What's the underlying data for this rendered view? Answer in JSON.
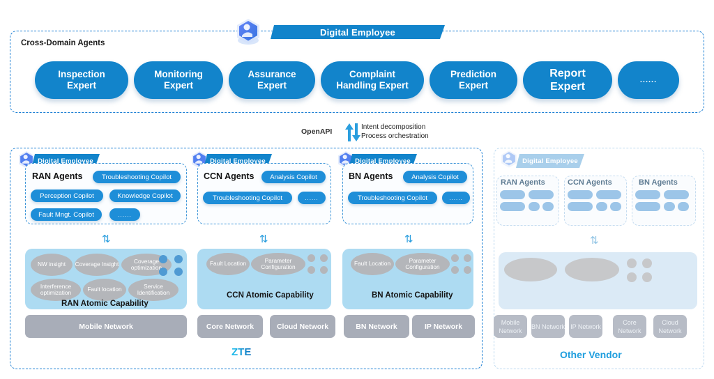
{
  "header": {
    "banner_label": "Digital Employee",
    "cube_icon": "digital-employee-cube-icon"
  },
  "top_section": {
    "label": "Cross-Domain Agents",
    "experts": [
      {
        "label": "Inspection\nExpert",
        "lines": [
          "Inspection",
          "Expert"
        ]
      },
      {
        "label": "Monitoring Expert",
        "lines": [
          "Monitoring",
          "Expert"
        ]
      },
      {
        "label": "Assurance Expert",
        "lines": [
          "Assurance",
          "Expert"
        ]
      },
      {
        "label": "Complaint Handling Expert",
        "lines": [
          "Complaint",
          "Handling Expert"
        ]
      },
      {
        "label": "Prediction Expert",
        "lines": [
          "Prediction",
          "Expert"
        ]
      },
      {
        "label": "Report Expert",
        "lines": [
          "Report",
          "Expert"
        ]
      },
      {
        "label": "......",
        "lines": [
          "......"
        ]
      }
    ]
  },
  "connector": {
    "openapi_label": "OpenAPI",
    "line1": "Intent decomposition",
    "line2": "Process orchestration",
    "arrow_icon": "up-down-arrows-icon"
  },
  "zte": {
    "vendor_label": "ZTE",
    "banner_label": "Digital Employee",
    "agent_groups": [
      {
        "title": "RAN Agents",
        "pills": [
          "Troubleshooting Copilot",
          "Perception Copilot",
          "Knowledge Copilot",
          "Fault Mngt. Copilot",
          "......"
        ]
      },
      {
        "title": "CCN Agents",
        "pills": [
          "Analysis Copilot",
          "Troubleshooting Copilot",
          "......"
        ]
      },
      {
        "title": "BN Agents",
        "pills": [
          "Analysis Copilot",
          "Troubleshooting Copilot",
          "......"
        ]
      }
    ],
    "atomic": [
      {
        "title": "RAN Atomic  Capability",
        "capabilities": [
          "NW insight",
          "Coverage Insight",
          "Coverage optimization",
          "Interference optimization",
          "Fault location",
          "Service Identification"
        ],
        "dot_color": "#4f9ad3"
      },
      {
        "title": "CCN Atomic  Capability",
        "capabilities": [
          "Fault Location",
          "Parameter Configuration"
        ],
        "dot_color": "#b4b6ba"
      },
      {
        "title": "BN Atomic  Capability",
        "capabilities": [
          "Fault Location",
          "Parameter Configuration"
        ],
        "dot_color": "#b4b6ba"
      }
    ],
    "networks": [
      "Mobile Network",
      "Core Network",
      "Cloud Network",
      "BN Network",
      "IP Network"
    ]
  },
  "other_vendor": {
    "vendor_label": "Other Vendor",
    "banner_label": "Digital Employee",
    "agent_groups": [
      {
        "title": "RAN Agents"
      },
      {
        "title": "CCN Agents"
      },
      {
        "title": "BN Agents"
      }
    ],
    "networks": [
      "Mobile Network",
      "BN Network",
      "IP Network",
      "Core Network",
      "Cloud Network"
    ]
  }
}
